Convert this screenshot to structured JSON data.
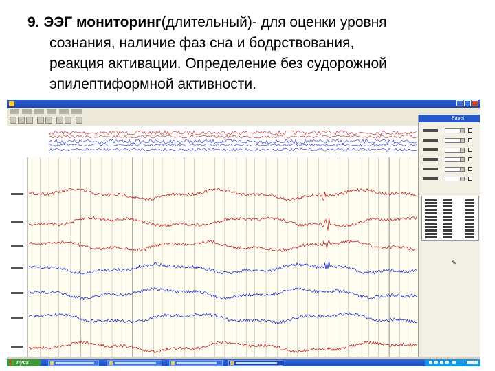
{
  "slide": {
    "number": "9.",
    "term": "ЭЭГ мониторинг",
    "lines": [
      "(длительный)- для оценки уровня",
      "сознания, наличие фаз сна и бодрствования,",
      "реакция активации. Определение без судорожной",
      "эпилептиформной активности."
    ]
  },
  "app": {
    "panel_title": "Panel"
  },
  "taskbar": {
    "start_label": "пуск"
  },
  "colors": {
    "titlebar": "#1b44b4",
    "eeg_trace_red": "#c02020",
    "eeg_trace_blue": "#1a2fd0",
    "taskbar": "#245edc",
    "start_button": "#3a9a35",
    "panel_bg": "#f2f0e4"
  },
  "icons": {
    "start": "windows-flag-icon",
    "close": "close-icon",
    "minimize": "minimize-icon",
    "maximize": "maximize-icon",
    "pen": "pen-icon"
  }
}
